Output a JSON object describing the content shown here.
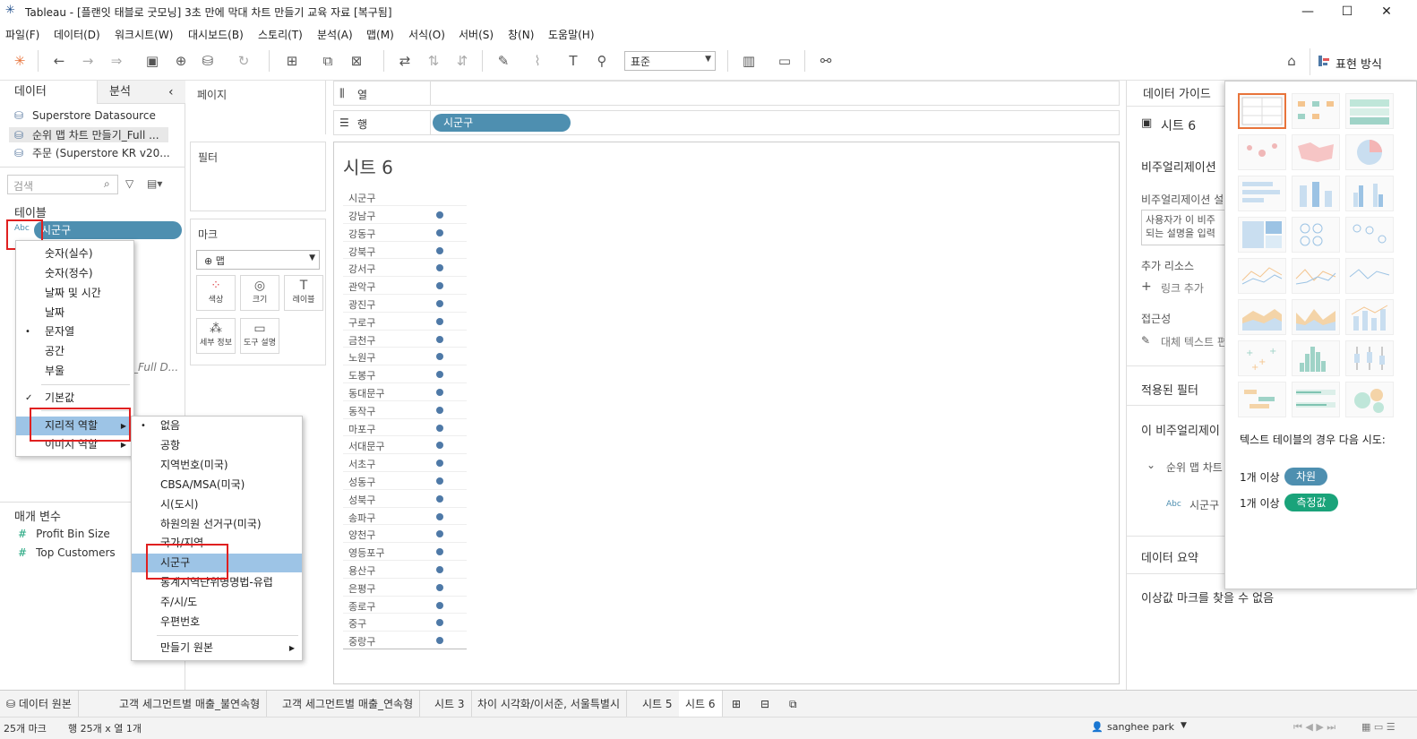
{
  "window": {
    "title": "Tableau - [플랜잇 태블로 굿모닝] 3초 만에 막대 차트 만들기 교육 자료 [복구됨]",
    "minimize": "—",
    "maximize": "☐",
    "close": "✕"
  },
  "menubar": [
    "파일(F)",
    "데이터(D)",
    "워크시트(W)",
    "대시보드(B)",
    "스토리(T)",
    "분석(A)",
    "맵(M)",
    "서식(O)",
    "서버(S)",
    "창(N)",
    "도움말(H)"
  ],
  "toolbar": {
    "fit_value": "표준",
    "show_me_label": "표현 방식"
  },
  "left_pane": {
    "tab_data": "데이터",
    "tab_analysis": "분석",
    "datasources": [
      "Superstore Datasource",
      "순위 맵 차트 만들기_Full ...",
      "주문 (Superstore KR v20..."
    ],
    "search_placeholder": "검색",
    "tables_header": "테이블",
    "field_pill": "시군구",
    "field_type": "Abc",
    "hidden_fragment": "_Full D...",
    "params_header": "매개 변수",
    "params": [
      "Profit Bin Size",
      "Top Customers"
    ]
  },
  "type_menu": {
    "items": [
      "숫자(실수)",
      "숫자(정수)",
      "날짜 및 시간",
      "날짜",
      "문자열",
      "공간",
      "부울"
    ],
    "checked": "•",
    "default_label": "기본값",
    "default_mark": "✓",
    "geo_role": "지리적 역할",
    "image_role": "이미지 역할"
  },
  "geo_submenu": {
    "items": [
      "없음",
      "공항",
      "지역번호(미국)",
      "CBSA/MSA(미국)",
      "시(도시)",
      "하원의원 선거구(미국)",
      "국가/지역",
      "시군구",
      "통계지역단위명명법-유럽",
      "주/시/도",
      "우편번호"
    ],
    "create_from": "만들기 원본",
    "selected_mark": "•"
  },
  "shelves": {
    "pages": "페이지",
    "filters": "필터",
    "marks": "마크",
    "mark_type": "맵",
    "mark_buttons": [
      "색상",
      "크기",
      "레이블",
      "세부 정보",
      "도구 설명"
    ],
    "columns": "열",
    "rows": "행",
    "row_pill": "시군구"
  },
  "view": {
    "sheet_title": "시트 6",
    "column_header": "시군구",
    "rows": [
      "강남구",
      "강동구",
      "강북구",
      "강서구",
      "관악구",
      "광진구",
      "구로구",
      "금천구",
      "노원구",
      "도봉구",
      "동대문구",
      "동작구",
      "마포구",
      "서대문구",
      "서초구",
      "성동구",
      "성북구",
      "송파구",
      "양천구",
      "영등포구",
      "용산구",
      "은평구",
      "종로구",
      "중구",
      "중랑구"
    ]
  },
  "data_guide": {
    "title": "데이터 가이드",
    "sheet": "시트 6",
    "viz_header": "비주얼리제이션",
    "viz_desc_label": "비주얼리제이션 설",
    "desc_placeholder_1": "사용자가 이 비주",
    "desc_placeholder_2": "되는 설명을 입력",
    "resources": "추가 리소스",
    "add_link": "링크 추가",
    "accessibility": "접근성",
    "alt_text": "대체 텍스트 편",
    "applied_filters": "적용된 필터",
    "this_viz": "이 비주얼리제이",
    "source_node": "순위 맵 차트",
    "source_field": "시군구",
    "data_summary": "데이터 요약",
    "no_outliers": "이상값 마크를 찾을 수 없음"
  },
  "show_me": {
    "hint": "텍스트 테이블의 경우 다음 시도:",
    "req1_prefix": "1개 이상",
    "req1_badge": "차원",
    "req2_prefix": "1개 이상",
    "req2_badge": "측정값",
    "dim_color": "#4e8fb0",
    "measure_color": "#1aa37a"
  },
  "sheet_tabs": [
    "데이터 원본",
    "고객 세그먼트별 매출_불연속형",
    "고객 세그먼트별 매출_연속형",
    "시트 3",
    "차이 시각화/이서준, 서울특별시",
    "시트 5",
    "시트 6"
  ],
  "status": {
    "marks": "25개 마크",
    "dims": "행 25개  x  열 1개",
    "user": "sanghee park"
  }
}
